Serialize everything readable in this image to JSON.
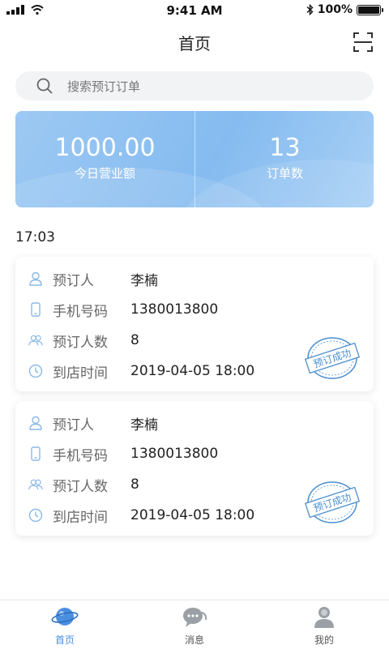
{
  "status_bar": {
    "time": "9:41 AM",
    "battery": "100%",
    "battery_level": 1.0
  },
  "header": {
    "title": "首页"
  },
  "search": {
    "placeholder": "搜索预订订单"
  },
  "stats": [
    {
      "value": "1000.00",
      "label": "今日营业额"
    },
    {
      "value": "13",
      "label": "订单数"
    }
  ],
  "time_label": "17:03",
  "orders": [
    {
      "rows": [
        {
          "label": "预订人",
          "value": "李楠"
        },
        {
          "label": "手机号码",
          "value": "1380013800"
        },
        {
          "label": "预订人数",
          "value": "8"
        },
        {
          "label": "到店时间",
          "value": "2019-04-05 18:00"
        }
      ],
      "stamp": "预订成功"
    },
    {
      "rows": [
        {
          "label": "预订人",
          "value": "李楠"
        },
        {
          "label": "手机号码",
          "value": "1380013800"
        },
        {
          "label": "预订人数",
          "value": "8"
        },
        {
          "label": "到店时间",
          "value": "2019-04-05 18:00"
        }
      ],
      "stamp": "预订成功"
    }
  ],
  "tabs": [
    {
      "label": "首页",
      "icon": "planet-icon",
      "active": true
    },
    {
      "label": "消息",
      "icon": "chat-bubble-icon",
      "active": false
    },
    {
      "label": "我的",
      "icon": "user-icon",
      "active": false
    }
  ],
  "colors": {
    "accent": "#4b8fe0",
    "card_gradient": "#85bbf0",
    "stamp": "#4a8fd0"
  }
}
